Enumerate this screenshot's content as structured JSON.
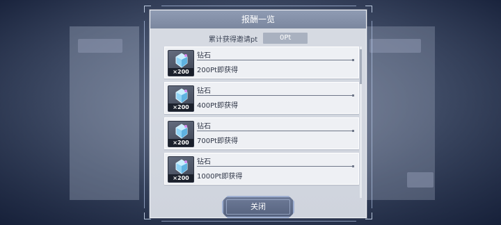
{
  "dialog": {
    "title": "报酬一览",
    "points_label": "累计获得邀请pt",
    "points_value": "0Pt",
    "close_label": "关闭"
  },
  "rewards": [
    {
      "name": "钻石",
      "quantity": "×200",
      "condition": "200Pt即获得"
    },
    {
      "name": "钻石",
      "quantity": "×200",
      "condition": "400Pt即获得"
    },
    {
      "name": "钻石",
      "quantity": "×200",
      "condition": "700Pt即获得"
    },
    {
      "name": "钻石",
      "quantity": "×200",
      "condition": "1000Pt即获得"
    }
  ],
  "colors": {
    "header": "#8693ab",
    "panel": "#d4d8e0",
    "item": "#eef0f4",
    "button": "#63708c"
  }
}
